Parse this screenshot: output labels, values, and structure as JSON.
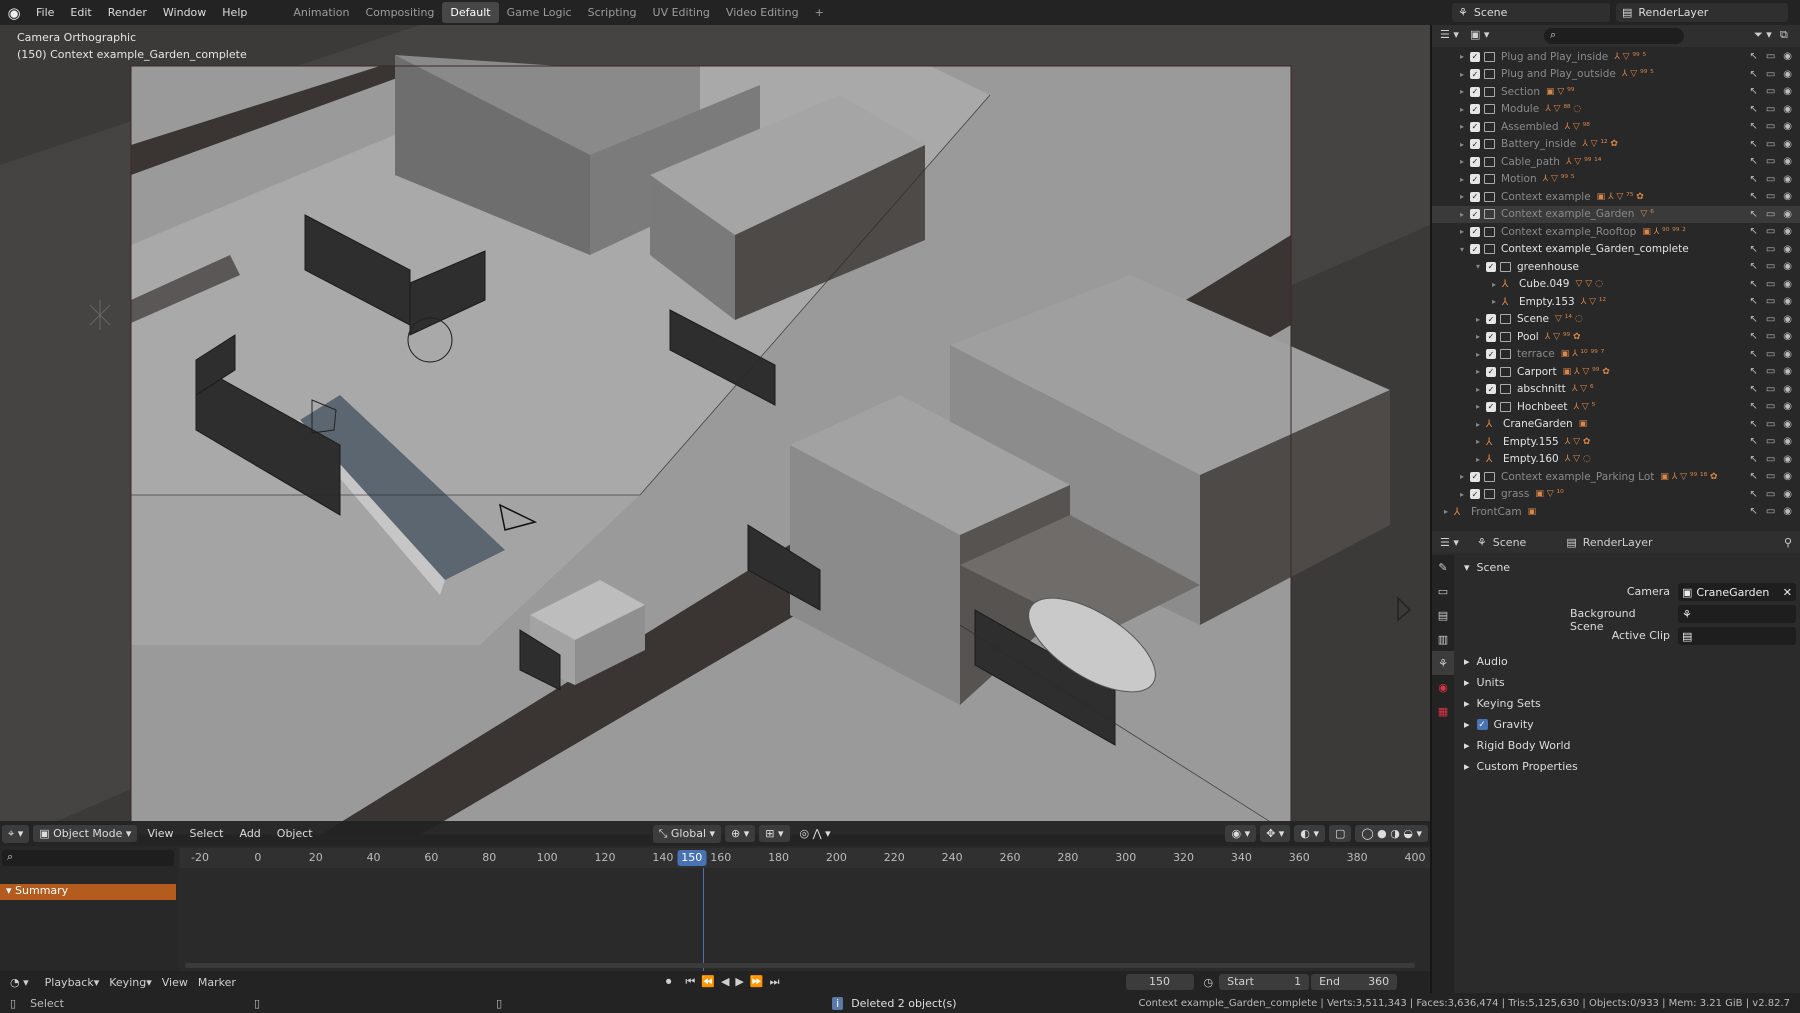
{
  "topbar": {
    "menus": [
      "File",
      "Edit",
      "Render",
      "Window",
      "Help"
    ],
    "workspaces": [
      "Animation",
      "Compositing",
      "Default",
      "Game Logic",
      "Scripting",
      "UV Editing",
      "Video Editing"
    ],
    "active_workspace": "Default",
    "add_tab": "+",
    "scene": "Scene",
    "render_layer": "RenderLayer"
  },
  "viewport": {
    "view_label": "Camera Orthographic",
    "collection_label": "(150) Context example_Garden_complete",
    "header": {
      "mode": "Object Mode",
      "menus": [
        "View",
        "Select",
        "Add",
        "Object"
      ],
      "orientation": "Global"
    }
  },
  "outliner": {
    "rows": [
      {
        "name": "Plug and Play_inside",
        "extra": "⅄ ▽ ⁹⁹ ⁵"
      },
      {
        "name": "Plug and Play_outside",
        "extra": "⅄ ▽ ⁹⁹ ⁵"
      },
      {
        "name": "Section",
        "extra": "▣ ▽ ⁹⁹"
      },
      {
        "name": "Module",
        "extra": "⅄ ▽ ⁸⁸ ◌"
      },
      {
        "name": "Assembled",
        "extra": "⅄ ▽ ⁹⁸"
      },
      {
        "name": "Battery_inside",
        "extra": "⅄ ▽ ¹² ✿"
      },
      {
        "name": "Cable_path",
        "extra": "⅄ ▽ ⁹⁹ ¹⁴"
      },
      {
        "name": "Motion",
        "extra": "⅄ ▽ ⁹⁹ ⁵"
      },
      {
        "name": "Context example",
        "extra": "▣ ⅄ ▽ ⁷⁵ ✿"
      },
      {
        "name": "Context example_Garden",
        "extra": "▽ ⁶"
      },
      {
        "name": "Context example_Rooftop",
        "extra": "▣ ⅄ ⁹⁰ ⁹⁹ ²"
      },
      {
        "name": "Context example_Garden_complete",
        "extra": ""
      },
      {
        "name": "greenhouse",
        "extra": ""
      },
      {
        "name": "Cube.049",
        "extra": "▽ ▽ ◌"
      },
      {
        "name": "Empty.153",
        "extra": "⅄ ▽ ¹²"
      },
      {
        "name": "Scene",
        "extra": "▽ ¹⁴ ◌"
      },
      {
        "name": "Pool",
        "extra": "⅄ ▽ ⁹⁹ ✿"
      },
      {
        "name": "terrace",
        "extra": "▣ ⅄ ¹⁰ ⁹⁹ ⁷"
      },
      {
        "name": "Carport",
        "extra": "▣ ⅄ ▽ ⁹⁹ ✿"
      },
      {
        "name": "abschnitt",
        "extra": "⅄ ▽ ⁶"
      },
      {
        "name": "Hochbeet",
        "extra": "⅄ ▽ ⁵"
      },
      {
        "name": "CraneGarden",
        "extra": "▣"
      },
      {
        "name": "Empty.155",
        "extra": "⅄ ▽ ✿"
      },
      {
        "name": "Empty.160",
        "extra": "⅄ ▽ ◌"
      },
      {
        "name": "Context example_Parking Lot",
        "extra": "▣ ⅄ ▽ ⁹⁹ ¹⁸ ✿"
      },
      {
        "name": "grass",
        "extra": "▣ ▽ ¹⁰"
      },
      {
        "name": "FrontCam",
        "extra": "▣"
      }
    ]
  },
  "properties": {
    "scene_tab": "Scene",
    "layer_tab": "RenderLayer",
    "panel_title": "Scene",
    "camera_label": "Camera",
    "camera_value": "CraneGarden",
    "background_scene_label": "Background Scene",
    "active_clip_label": "Active Clip",
    "sections": [
      "Audio",
      "Units",
      "Keying Sets",
      "Gravity",
      "Rigid Body World",
      "Custom Properties"
    ]
  },
  "timeline": {
    "ruler": [
      "-20",
      "0",
      "20",
      "40",
      "60",
      "80",
      "100",
      "120",
      "140",
      "150",
      "160",
      "180",
      "200",
      "220",
      "240",
      "260",
      "280",
      "300",
      "320",
      "340",
      "360",
      "380",
      "400"
    ],
    "current_frame": "150",
    "summary_label": "Summary",
    "menus": [
      "Playback",
      "Keying",
      "View",
      "Marker"
    ],
    "frame_field": "150",
    "start_label": "Start",
    "start_value": "1",
    "end_label": "End",
    "end_value": "360"
  },
  "status": {
    "left": "Select",
    "message": "Deleted 2 object(s)",
    "stats": "Context example_Garden_complete | Verts:3,511,343 | Faces:3,636,474 | Tris:5,125,630 | Objects:0/933 | Mem: 3.21 GiB | v2.82.7"
  },
  "colors": {
    "accent": "#4772b3",
    "summary": "#b35c1e",
    "icon_orange": "#d9874a"
  }
}
